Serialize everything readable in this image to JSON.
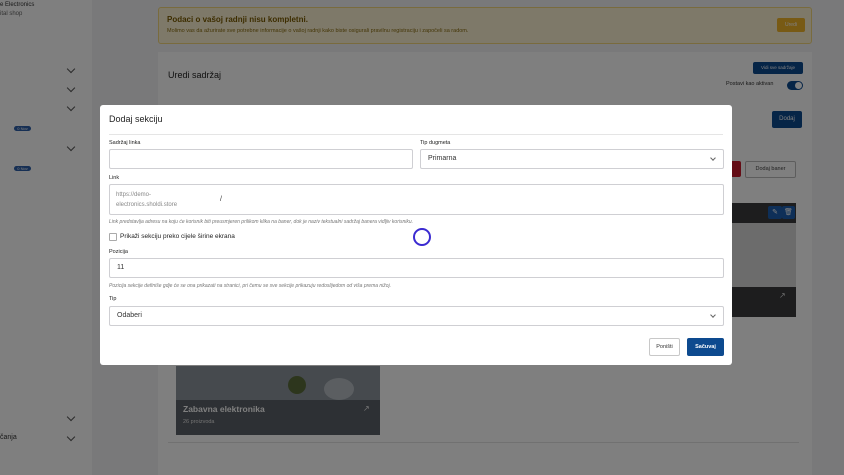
{
  "sidebar": {
    "brand_line1": "e Electronics",
    "brand_line2": "ital shop",
    "badge_1": "0 Nov",
    "badge_2": "0 Nov",
    "bottom_label": "čanja"
  },
  "alert": {
    "title": "Podaci o vašoj radnji nisu kompletni.",
    "text": "Molimo vas da ažurirate sve potrebne informacije o vašoj radnji kako biste osigurali pravilnu registraciju i započeli sa radom.",
    "button": "Uredi"
  },
  "content": {
    "title": "Uredi sadržaj",
    "all_content_button": "Vidi sve sadržaje",
    "active_label": "Postavi kao aktivan",
    "add_button": "Dodaj",
    "add_banner_button": "Dodaj baner",
    "category_name": "Zabavna elektronika",
    "category_count": "26 proizvoda"
  },
  "modal": {
    "title": "Dodaj sekciju",
    "link_text_label": "Sadržaj linka",
    "link_text_value": "",
    "button_type_label": "Tip dugmeta",
    "button_type_value": "Primarna",
    "link_label": "Link",
    "link_prefix": "https://demo-electronics.sholdi.store",
    "link_path": "/",
    "link_hint": "Link predstavlja adresu na koju će korisnik biti preusmjeren prilikom klika na baner, dok je naziv tekstualni sadržaj banera vidljiv korisniku.",
    "fullwidth_label": "Prikaži sekciju preko cijele širine ekrana",
    "position_label": "Pozicija",
    "position_value": "11",
    "position_hint": "Pozicija sekcije definiše gdje će se ona prikazati na stranici, pri čemu se sve sekcije prikazuju redoslijedom od viša prema nižoj.",
    "type_label": "Tip",
    "type_value": "Odaberi",
    "cancel_button": "Poništi",
    "save_button": "Sačuvaj"
  },
  "icons": {
    "edit": "pencil-icon",
    "delete": "trash-icon",
    "external": "arrow-up-right-icon"
  }
}
